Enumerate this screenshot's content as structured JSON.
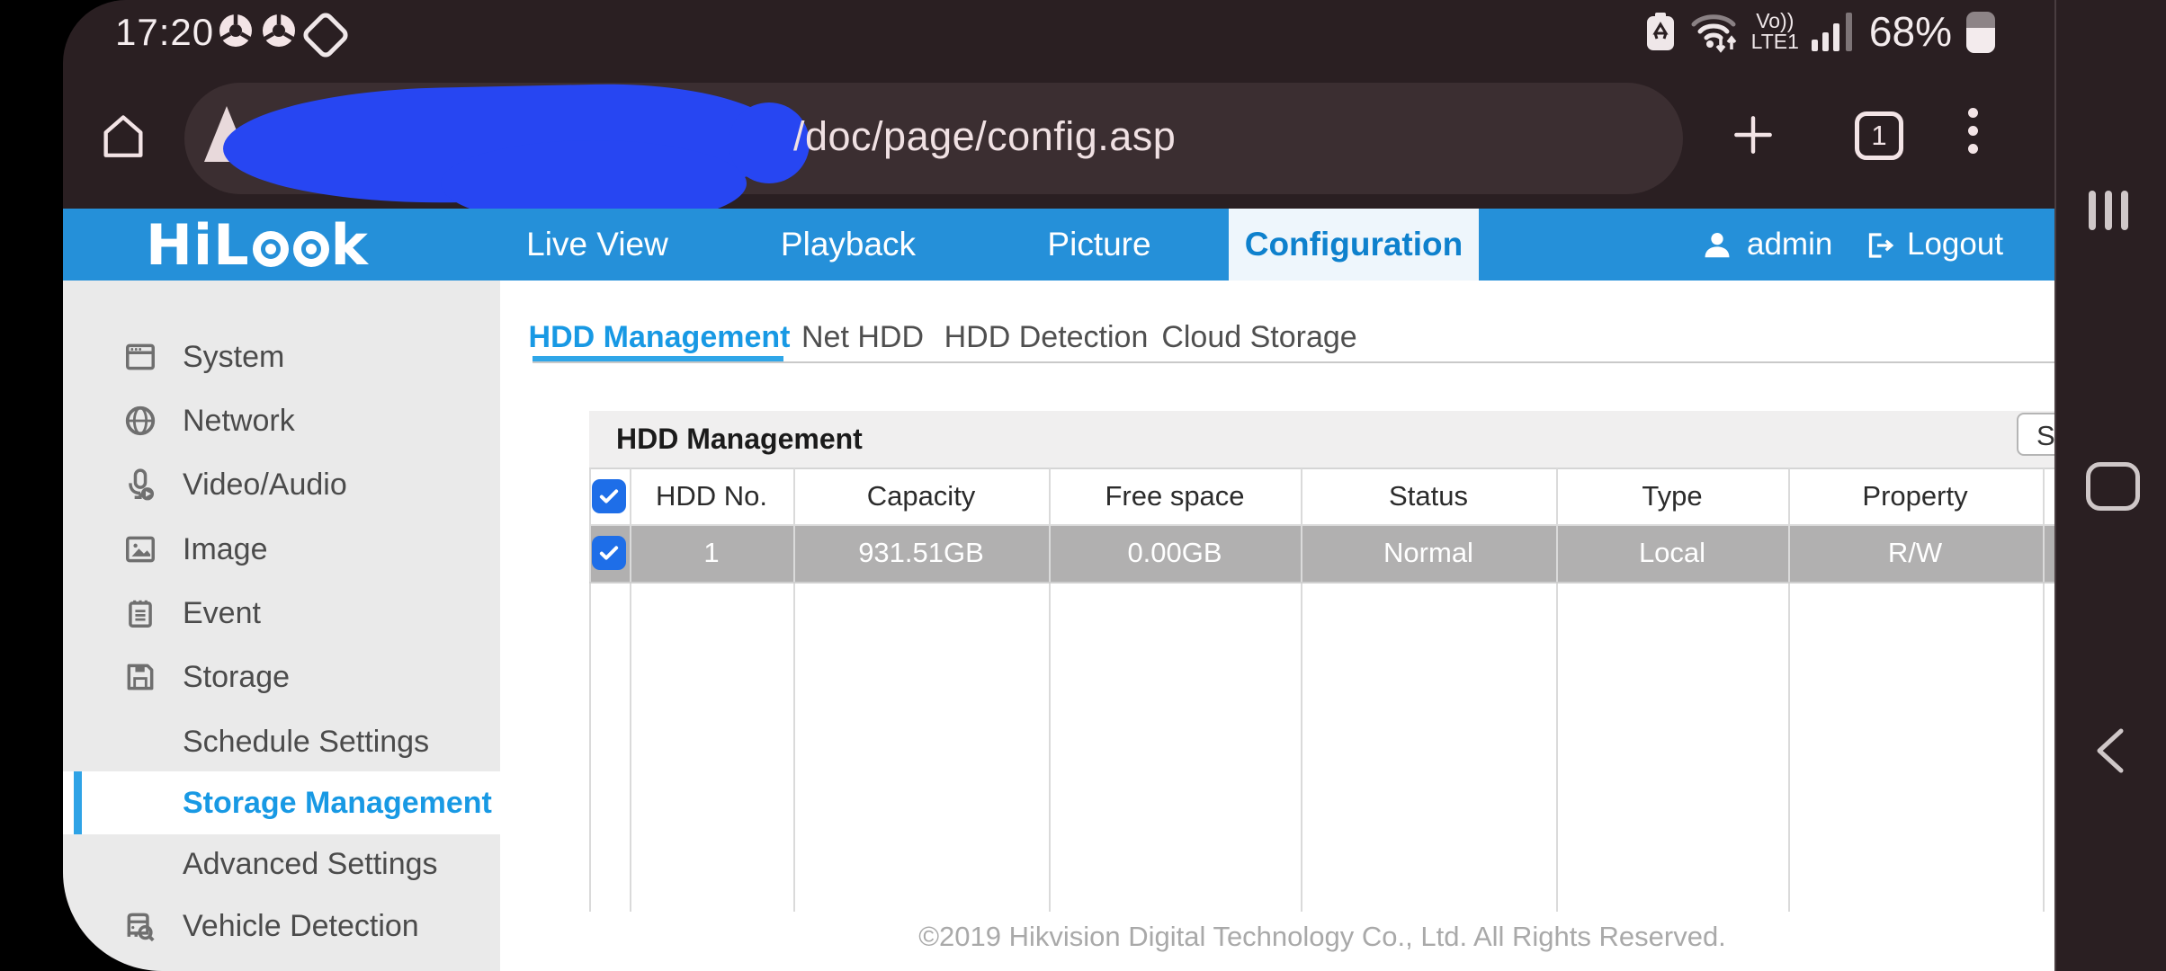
{
  "colors": {
    "header_blue": "#2590d9",
    "active_link_blue": "#1899e4",
    "tab_underline_blue": "#2fa6e8",
    "checkbox_blue": "#1e6ee8",
    "selected_row_gray": "#b1b0b0",
    "phone_chrome_dark": "#2a1f22",
    "redaction_scribble_blue": "#2746f2"
  },
  "status_bar": {
    "time": "17:20",
    "notification_icons": [
      "chrome-icon",
      "chrome-icon",
      "screen-rotation-icon"
    ],
    "network_label_top": "Vo))",
    "network_label_bottom": "LTE1",
    "battery_percent": "68%"
  },
  "browser_toolbar": {
    "url_path": "/doc/page/config.asp",
    "tab_count": "1"
  },
  "app_header": {
    "brand": "HiLook",
    "brand_prefix": "HiL",
    "brand_suffix": "k",
    "nav_items": [
      {
        "label": "Live View",
        "active": false
      },
      {
        "label": "Playback",
        "active": false
      },
      {
        "label": "Picture",
        "active": false
      },
      {
        "label": "Configuration",
        "active": true
      }
    ],
    "username": "admin",
    "logout_label": "Logout"
  },
  "sidebar": {
    "items": [
      {
        "label": "System",
        "icon": "system-window-icon",
        "active": false
      },
      {
        "label": "Network",
        "icon": "globe-icon",
        "active": false
      },
      {
        "label": "Video/Audio",
        "icon": "microphone-icon",
        "active": false
      },
      {
        "label": "Image",
        "icon": "image-icon",
        "active": false
      },
      {
        "label": "Event",
        "icon": "event-note-icon",
        "active": false
      },
      {
        "label": "Storage",
        "icon": "storage-disk-icon",
        "active": false
      },
      {
        "label": "Schedule Settings",
        "icon": null,
        "active": false
      },
      {
        "label": "Storage Management",
        "icon": null,
        "active": true
      },
      {
        "label": "Advanced Settings",
        "icon": null,
        "active": false
      },
      {
        "label": "Vehicle Detection",
        "icon": "vehicle-detection-icon",
        "active": false
      }
    ]
  },
  "content": {
    "tabs": [
      {
        "label": "HDD Management",
        "active": true
      },
      {
        "label": "Net HDD",
        "active": false
      },
      {
        "label": "HDD Detection",
        "active": false
      },
      {
        "label": "Cloud Storage",
        "active": false
      }
    ],
    "panel_title": "HDD Management",
    "action_button_partial": "S",
    "table": {
      "columns": [
        "HDD No.",
        "Capacity",
        "Free space",
        "Status",
        "Type",
        "Property"
      ],
      "rows": [
        {
          "checked": true,
          "cells": [
            "1",
            "931.51GB",
            "0.00GB",
            "Normal",
            "Local",
            "R/W"
          ]
        }
      ]
    },
    "footer": "©2019 Hikvision Digital Technology Co., Ltd. All Rights Reserved."
  }
}
